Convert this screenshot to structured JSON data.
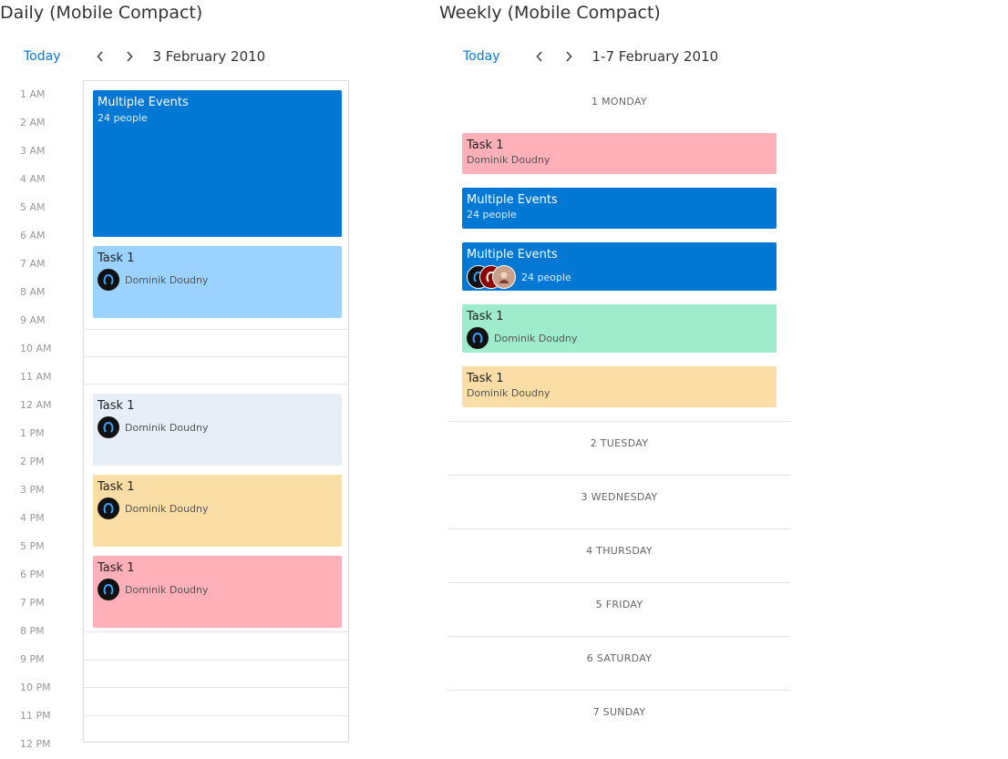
{
  "daily": {
    "title": "Daily (Mobile Compact)",
    "toolbar": {
      "today_label": "Today",
      "date_label": "3 February 2010"
    },
    "hours": [
      "1 AM",
      "2 AM",
      "3 AM",
      "4 AM",
      "5 AM",
      "6 AM",
      "7 AM",
      "8 AM",
      "9 AM",
      "10 AM",
      "11 AM",
      "12 AM",
      "1 PM",
      "2 PM",
      "3 PM",
      "4 PM",
      "5 PM",
      "6 PM",
      "7 PM",
      "8 PM",
      "9 PM",
      "10 PM",
      "11 PM",
      "12 PM"
    ],
    "events": [
      {
        "title": "Multiple Events",
        "subtitle": "24 people",
        "color": "#0078d4"
      },
      {
        "title": "Task 1",
        "person": "Dominik Doudny",
        "color": "#9ad3ff"
      },
      {
        "title": "Task 1",
        "person": "Dominik Doudny",
        "color": "#e6eef8"
      },
      {
        "title": "Task 1",
        "person": "Dominik Doudny",
        "color": "#fbdea6"
      },
      {
        "title": "Task 1",
        "person": "Dominik Doudny",
        "color": "#ffb0b9"
      }
    ]
  },
  "weekly": {
    "title": "Weekly (Mobile Compact)",
    "toolbar": {
      "today_label": "Today",
      "range_label": "1-7 February 2010"
    },
    "days": [
      "1 MONDAY",
      "2 TUESDAY",
      "3 WEDNESDAY",
      "4 THURSDAY",
      "5 FRIDAY",
      "6 SATURDAY",
      "7 SUNDAY"
    ],
    "monday_events": [
      {
        "title": "Task 1",
        "subtitle": "Dominik Doudny",
        "color": "#ffb0b9"
      },
      {
        "title": "Multiple Events",
        "subtitle": "24 people",
        "color": "#0078d4"
      },
      {
        "title": "Multiple Events",
        "people_label": "24 people",
        "color": "#0078d4"
      },
      {
        "title": "Task 1",
        "person": "Dominik Doudny",
        "color": "#9eeccb"
      },
      {
        "title": "Task 1",
        "subtitle": "Dominik Doudny",
        "color": "#fbdea6"
      }
    ]
  },
  "icons": {
    "prev": "chevron-left-icon",
    "next": "chevron-right-icon",
    "avatar": "user-avatar-icon"
  }
}
